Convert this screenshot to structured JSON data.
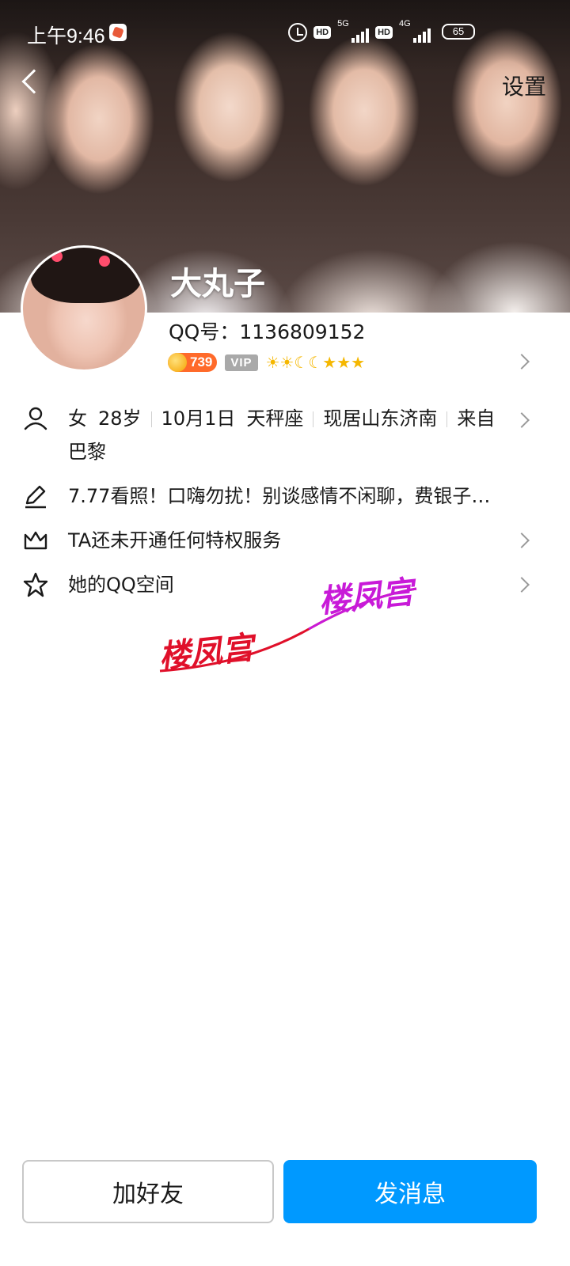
{
  "status_bar": {
    "time": "上午9:46",
    "hd1": "HD",
    "net1": "5G",
    "hd2": "HD",
    "net2": "4G",
    "battery": "65"
  },
  "header": {
    "settings_label": "设置"
  },
  "profile": {
    "nickname": "大丸子",
    "qq_number": "QQ号：1136809152",
    "level": "739",
    "vip": "VIP",
    "level_icons": "☀☀☾☾★★★"
  },
  "info": {
    "gender": "女",
    "age": "28岁",
    "birthday": "10月1日",
    "zodiac": "天秤座",
    "location": "现居山东济南",
    "hometown": "来自巴黎",
    "signature": "7.77看照！口嗨勿扰！别谈感情不闲聊，费银子…",
    "privilege": "TA还未开通任何特权服务",
    "qzone": "她的QQ空间"
  },
  "watermark": {
    "text1": "楼凤宫",
    "text2": "楼凤宫",
    "color1": "#e0102a",
    "color2": "#c81ad8"
  },
  "actions": {
    "add_friend": "加好友",
    "send_message": "发消息"
  },
  "colors": {
    "accent": "#0099ff"
  }
}
